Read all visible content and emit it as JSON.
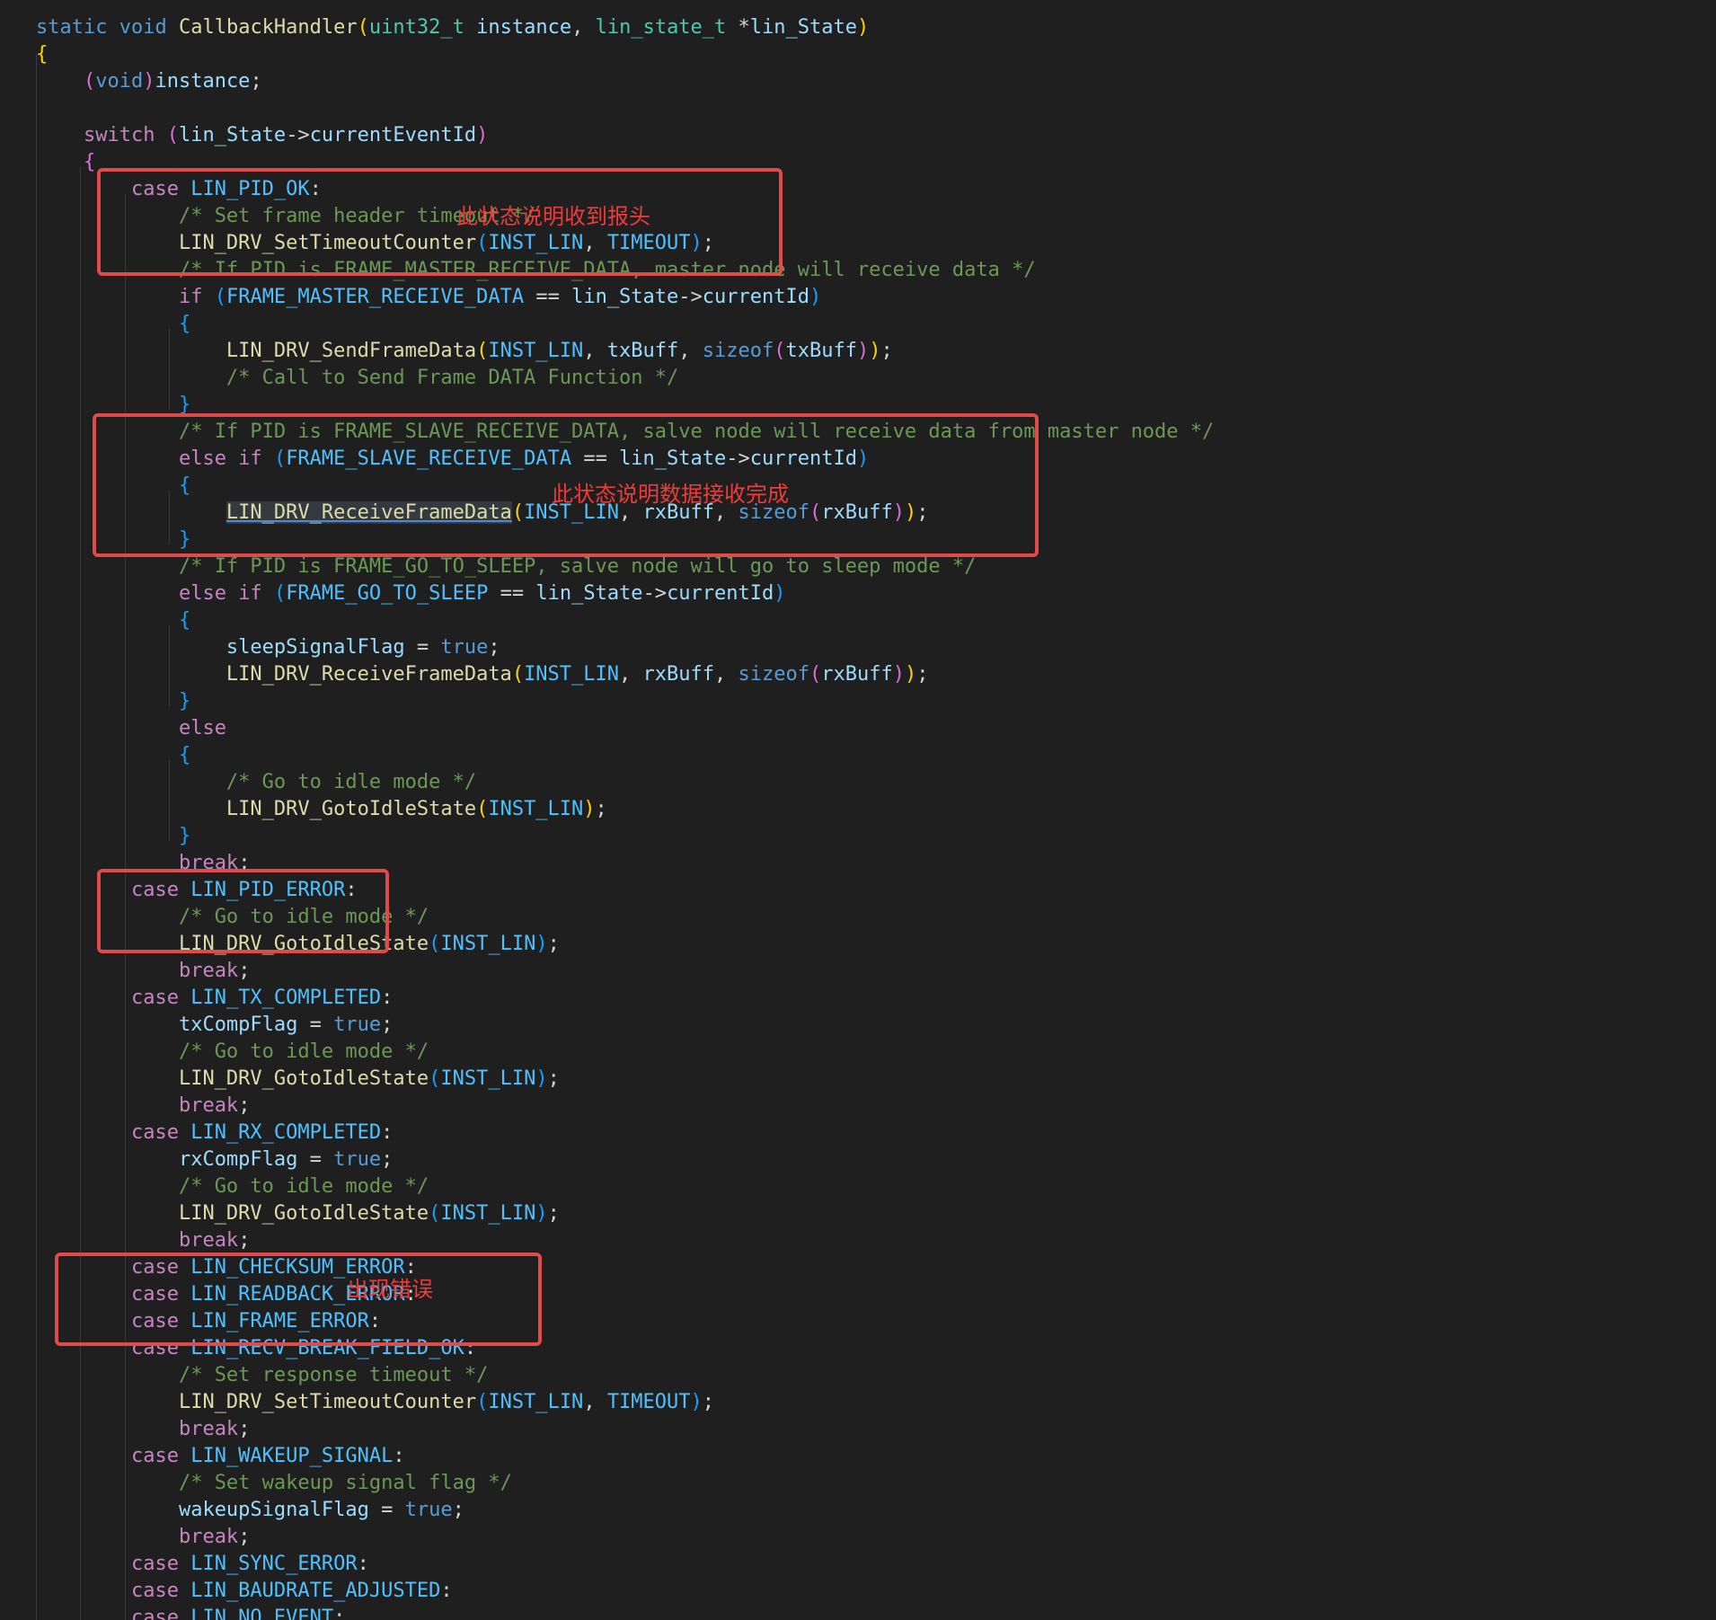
{
  "editor": {
    "lines": [
      [
        [
          "kw",
          "static"
        ],
        [
          "op",
          " "
        ],
        [
          "kw",
          "void"
        ],
        [
          "op",
          " "
        ],
        [
          "fn",
          "CallbackHandler"
        ],
        [
          "p1",
          "("
        ],
        [
          "type",
          "uint32_t"
        ],
        [
          "op",
          " "
        ],
        [
          "var",
          "instance"
        ],
        [
          "op",
          ", "
        ],
        [
          "type",
          "lin_state_t"
        ],
        [
          "op",
          " *"
        ],
        [
          "var",
          "lin_State"
        ],
        [
          "p1",
          ")"
        ]
      ],
      [
        [
          "p1",
          "{"
        ]
      ],
      [
        [
          "op",
          "    "
        ],
        [
          "p2",
          "("
        ],
        [
          "kw",
          "void"
        ],
        [
          "p2",
          ")"
        ],
        [
          "var",
          "instance"
        ],
        [
          "op",
          ";"
        ]
      ],
      [],
      [
        [
          "op",
          "    "
        ],
        [
          "ctl",
          "switch"
        ],
        [
          "op",
          " "
        ],
        [
          "p2",
          "("
        ],
        [
          "var",
          "lin_State"
        ],
        [
          "op",
          "->"
        ],
        [
          "var",
          "currentEventId"
        ],
        [
          "p2",
          ")"
        ]
      ],
      [
        [
          "op",
          "    "
        ],
        [
          "p2",
          "{"
        ]
      ],
      [
        [
          "op",
          "        "
        ],
        [
          "ctl",
          "case"
        ],
        [
          "op",
          " "
        ],
        [
          "const",
          "LIN_PID_OK"
        ],
        [
          "op",
          ":"
        ]
      ],
      [
        [
          "op",
          "            "
        ],
        [
          "cm",
          "/* Set frame header timeout */"
        ]
      ],
      [
        [
          "op",
          "            "
        ],
        [
          "fn",
          "LIN_DRV_SetTimeoutCounter"
        ],
        [
          "p3",
          "("
        ],
        [
          "const",
          "INST_LIN"
        ],
        [
          "op",
          ", "
        ],
        [
          "const",
          "TIMEOUT"
        ],
        [
          "p3",
          ")"
        ],
        [
          "op",
          ";"
        ]
      ],
      [
        [
          "op",
          "            "
        ],
        [
          "cm",
          "/* If PID is FRAME_MASTER_RECEIVE_DATA, master node will receive data */"
        ]
      ],
      [
        [
          "op",
          "            "
        ],
        [
          "ctl",
          "if"
        ],
        [
          "op",
          " "
        ],
        [
          "p3",
          "("
        ],
        [
          "const",
          "FRAME_MASTER_RECEIVE_DATA"
        ],
        [
          "op",
          " == "
        ],
        [
          "var",
          "lin_State"
        ],
        [
          "op",
          "->"
        ],
        [
          "var",
          "currentId"
        ],
        [
          "p3",
          ")"
        ]
      ],
      [
        [
          "op",
          "            "
        ],
        [
          "p3",
          "{"
        ]
      ],
      [
        [
          "op",
          "                "
        ],
        [
          "fn",
          "LIN_DRV_SendFrameData"
        ],
        [
          "p1",
          "("
        ],
        [
          "const",
          "INST_LIN"
        ],
        [
          "op",
          ", "
        ],
        [
          "var",
          "txBuff"
        ],
        [
          "op",
          ", "
        ],
        [
          "kw",
          "sizeof"
        ],
        [
          "p2",
          "("
        ],
        [
          "var",
          "txBuff"
        ],
        [
          "p2",
          ")"
        ],
        [
          "p1",
          ")"
        ],
        [
          "op",
          ";"
        ]
      ],
      [
        [
          "op",
          "                "
        ],
        [
          "cm",
          "/* Call to Send Frame DATA Function */"
        ]
      ],
      [
        [
          "op",
          "            "
        ],
        [
          "p3",
          "}"
        ]
      ],
      [
        [
          "op",
          "            "
        ],
        [
          "cm",
          "/* If PID is FRAME_SLAVE_RECEIVE_DATA, salve node will receive data from master node */"
        ]
      ],
      [
        [
          "op",
          "            "
        ],
        [
          "ctl",
          "else"
        ],
        [
          "op",
          " "
        ],
        [
          "ctl",
          "if"
        ],
        [
          "op",
          " "
        ],
        [
          "p3",
          "("
        ],
        [
          "const",
          "FRAME_SLAVE_RECEIVE_DATA"
        ],
        [
          "op",
          " == "
        ],
        [
          "var",
          "lin_State"
        ],
        [
          "op",
          "->"
        ],
        [
          "var",
          "currentId"
        ],
        [
          "p3",
          ")"
        ]
      ],
      [
        [
          "op",
          "            "
        ],
        [
          "p3",
          "{"
        ]
      ],
      [
        [
          "op",
          "                "
        ],
        [
          "link",
          "LIN_DRV_ReceiveFrameData"
        ],
        [
          "p1",
          "("
        ],
        [
          "const",
          "INST_LIN"
        ],
        [
          "op",
          ", "
        ],
        [
          "var",
          "rxBuff"
        ],
        [
          "op",
          ", "
        ],
        [
          "kw",
          "sizeof"
        ],
        [
          "p2",
          "("
        ],
        [
          "var",
          "rxBuff"
        ],
        [
          "p2",
          ")"
        ],
        [
          "p1",
          ")"
        ],
        [
          "op",
          ";"
        ]
      ],
      [
        [
          "op",
          "            "
        ],
        [
          "p3",
          "}"
        ]
      ],
      [
        [
          "op",
          "            "
        ],
        [
          "cm",
          "/* If PID is FRAME_GO_TO_SLEEP, salve node will go to sleep mode */"
        ]
      ],
      [
        [
          "op",
          "            "
        ],
        [
          "ctl",
          "else"
        ],
        [
          "op",
          " "
        ],
        [
          "ctl",
          "if"
        ],
        [
          "op",
          " "
        ],
        [
          "p3",
          "("
        ],
        [
          "const",
          "FRAME_GO_TO_SLEEP"
        ],
        [
          "op",
          " == "
        ],
        [
          "var",
          "lin_State"
        ],
        [
          "op",
          "->"
        ],
        [
          "var",
          "currentId"
        ],
        [
          "p3",
          ")"
        ]
      ],
      [
        [
          "op",
          "            "
        ],
        [
          "p3",
          "{"
        ]
      ],
      [
        [
          "op",
          "                "
        ],
        [
          "var",
          "sleepSignalFlag"
        ],
        [
          "op",
          " = "
        ],
        [
          "kw",
          "true"
        ],
        [
          "op",
          ";"
        ]
      ],
      [
        [
          "op",
          "                "
        ],
        [
          "fn",
          "LIN_DRV_ReceiveFrameData"
        ],
        [
          "p1",
          "("
        ],
        [
          "const",
          "INST_LIN"
        ],
        [
          "op",
          ", "
        ],
        [
          "var",
          "rxBuff"
        ],
        [
          "op",
          ", "
        ],
        [
          "kw",
          "sizeof"
        ],
        [
          "p2",
          "("
        ],
        [
          "var",
          "rxBuff"
        ],
        [
          "p2",
          ")"
        ],
        [
          "p1",
          ")"
        ],
        [
          "op",
          ";"
        ]
      ],
      [
        [
          "op",
          "            "
        ],
        [
          "p3",
          "}"
        ]
      ],
      [
        [
          "op",
          "            "
        ],
        [
          "ctl",
          "else"
        ]
      ],
      [
        [
          "op",
          "            "
        ],
        [
          "p3",
          "{"
        ]
      ],
      [
        [
          "op",
          "                "
        ],
        [
          "cm",
          "/* Go to idle mode */"
        ]
      ],
      [
        [
          "op",
          "                "
        ],
        [
          "fn",
          "LIN_DRV_GotoIdleState"
        ],
        [
          "p1",
          "("
        ],
        [
          "const",
          "INST_LIN"
        ],
        [
          "p1",
          ")"
        ],
        [
          "op",
          ";"
        ]
      ],
      [
        [
          "op",
          "            "
        ],
        [
          "p3",
          "}"
        ]
      ],
      [
        [
          "op",
          "            "
        ],
        [
          "ctl",
          "break"
        ],
        [
          "op",
          ";"
        ]
      ],
      [
        [
          "op",
          "        "
        ],
        [
          "ctl",
          "case"
        ],
        [
          "op",
          " "
        ],
        [
          "const",
          "LIN_PID_ERROR"
        ],
        [
          "op",
          ":"
        ]
      ],
      [
        [
          "op",
          "            "
        ],
        [
          "cm",
          "/* Go to idle mode */"
        ]
      ],
      [
        [
          "op",
          "            "
        ],
        [
          "fn",
          "LIN_DRV_GotoIdleState"
        ],
        [
          "p3",
          "("
        ],
        [
          "const",
          "INST_LIN"
        ],
        [
          "p3",
          ")"
        ],
        [
          "op",
          ";"
        ]
      ],
      [
        [
          "op",
          "            "
        ],
        [
          "ctl",
          "break"
        ],
        [
          "op",
          ";"
        ]
      ],
      [
        [
          "op",
          "        "
        ],
        [
          "ctl",
          "case"
        ],
        [
          "op",
          " "
        ],
        [
          "const",
          "LIN_TX_COMPLETED"
        ],
        [
          "op",
          ":"
        ]
      ],
      [
        [
          "op",
          "            "
        ],
        [
          "var",
          "txCompFlag"
        ],
        [
          "op",
          " = "
        ],
        [
          "kw",
          "true"
        ],
        [
          "op",
          ";"
        ]
      ],
      [
        [
          "op",
          "            "
        ],
        [
          "cm",
          "/* Go to idle mode */"
        ]
      ],
      [
        [
          "op",
          "            "
        ],
        [
          "fn",
          "LIN_DRV_GotoIdleState"
        ],
        [
          "p3",
          "("
        ],
        [
          "const",
          "INST_LIN"
        ],
        [
          "p3",
          ")"
        ],
        [
          "op",
          ";"
        ]
      ],
      [
        [
          "op",
          "            "
        ],
        [
          "ctl",
          "break"
        ],
        [
          "op",
          ";"
        ]
      ],
      [
        [
          "op",
          "        "
        ],
        [
          "ctl",
          "case"
        ],
        [
          "op",
          " "
        ],
        [
          "const",
          "LIN_RX_COMPLETED"
        ],
        [
          "op",
          ":"
        ]
      ],
      [
        [
          "op",
          "            "
        ],
        [
          "var",
          "rxCompFlag"
        ],
        [
          "op",
          " = "
        ],
        [
          "kw",
          "true"
        ],
        [
          "op",
          ";"
        ]
      ],
      [
        [
          "op",
          "            "
        ],
        [
          "cm",
          "/* Go to idle mode */"
        ]
      ],
      [
        [
          "op",
          "            "
        ],
        [
          "fn",
          "LIN_DRV_GotoIdleState"
        ],
        [
          "p3",
          "("
        ],
        [
          "const",
          "INST_LIN"
        ],
        [
          "p3",
          ")"
        ],
        [
          "op",
          ";"
        ]
      ],
      [
        [
          "op",
          "            "
        ],
        [
          "ctl",
          "break"
        ],
        [
          "op",
          ";"
        ]
      ],
      [
        [
          "op",
          "        "
        ],
        [
          "ctl",
          "case"
        ],
        [
          "op",
          " "
        ],
        [
          "const",
          "LIN_CHECKSUM_ERROR"
        ],
        [
          "op",
          ":"
        ]
      ],
      [
        [
          "op",
          "        "
        ],
        [
          "ctl",
          "case"
        ],
        [
          "op",
          " "
        ],
        [
          "const",
          "LIN_READBACK_ERROR"
        ],
        [
          "op",
          ":"
        ]
      ],
      [
        [
          "op",
          "        "
        ],
        [
          "ctl",
          "case"
        ],
        [
          "op",
          " "
        ],
        [
          "const",
          "LIN_FRAME_ERROR"
        ],
        [
          "op",
          ":"
        ]
      ],
      [
        [
          "op",
          "        "
        ],
        [
          "ctl",
          "case"
        ],
        [
          "op",
          " "
        ],
        [
          "const",
          "LIN_RECV_BREAK_FIELD_OK"
        ],
        [
          "op",
          ":"
        ]
      ],
      [
        [
          "op",
          "            "
        ],
        [
          "cm",
          "/* Set response timeout */"
        ]
      ],
      [
        [
          "op",
          "            "
        ],
        [
          "fn",
          "LIN_DRV_SetTimeoutCounter"
        ],
        [
          "p3",
          "("
        ],
        [
          "const",
          "INST_LIN"
        ],
        [
          "op",
          ", "
        ],
        [
          "const",
          "TIMEOUT"
        ],
        [
          "p3",
          ")"
        ],
        [
          "op",
          ";"
        ]
      ],
      [
        [
          "op",
          "            "
        ],
        [
          "ctl",
          "break"
        ],
        [
          "op",
          ";"
        ]
      ],
      [
        [
          "op",
          "        "
        ],
        [
          "ctl",
          "case"
        ],
        [
          "op",
          " "
        ],
        [
          "const",
          "LIN_WAKEUP_SIGNAL"
        ],
        [
          "op",
          ":"
        ]
      ],
      [
        [
          "op",
          "            "
        ],
        [
          "cm",
          "/* Set wakeup signal flag */"
        ]
      ],
      [
        [
          "op",
          "            "
        ],
        [
          "var",
          "wakeupSignalFlag"
        ],
        [
          "op",
          " = "
        ],
        [
          "kw",
          "true"
        ],
        [
          "op",
          ";"
        ]
      ],
      [
        [
          "op",
          "            "
        ],
        [
          "ctl",
          "break"
        ],
        [
          "op",
          ";"
        ]
      ],
      [
        [
          "op",
          "        "
        ],
        [
          "ctl",
          "case"
        ],
        [
          "op",
          " "
        ],
        [
          "const",
          "LIN_SYNC_ERROR"
        ],
        [
          "op",
          ":"
        ]
      ],
      [
        [
          "op",
          "        "
        ],
        [
          "ctl",
          "case"
        ],
        [
          "op",
          " "
        ],
        [
          "const",
          "LIN_BAUDRATE_ADJUSTED"
        ],
        [
          "op",
          ":"
        ]
      ],
      [
        [
          "op",
          "        "
        ],
        [
          "ctl",
          "case"
        ],
        [
          "op",
          " "
        ],
        [
          "const",
          "LIN_NO_EVENT"
        ],
        [
          "op",
          ":"
        ]
      ]
    ]
  },
  "annotations": {
    "note_header_received": "此状态说明收到报头",
    "note_data_received": "此状态说明数据接收完成",
    "note_error": "出现错误",
    "box_color": "#e04a4a",
    "text_color": "#ee3b3b"
  }
}
